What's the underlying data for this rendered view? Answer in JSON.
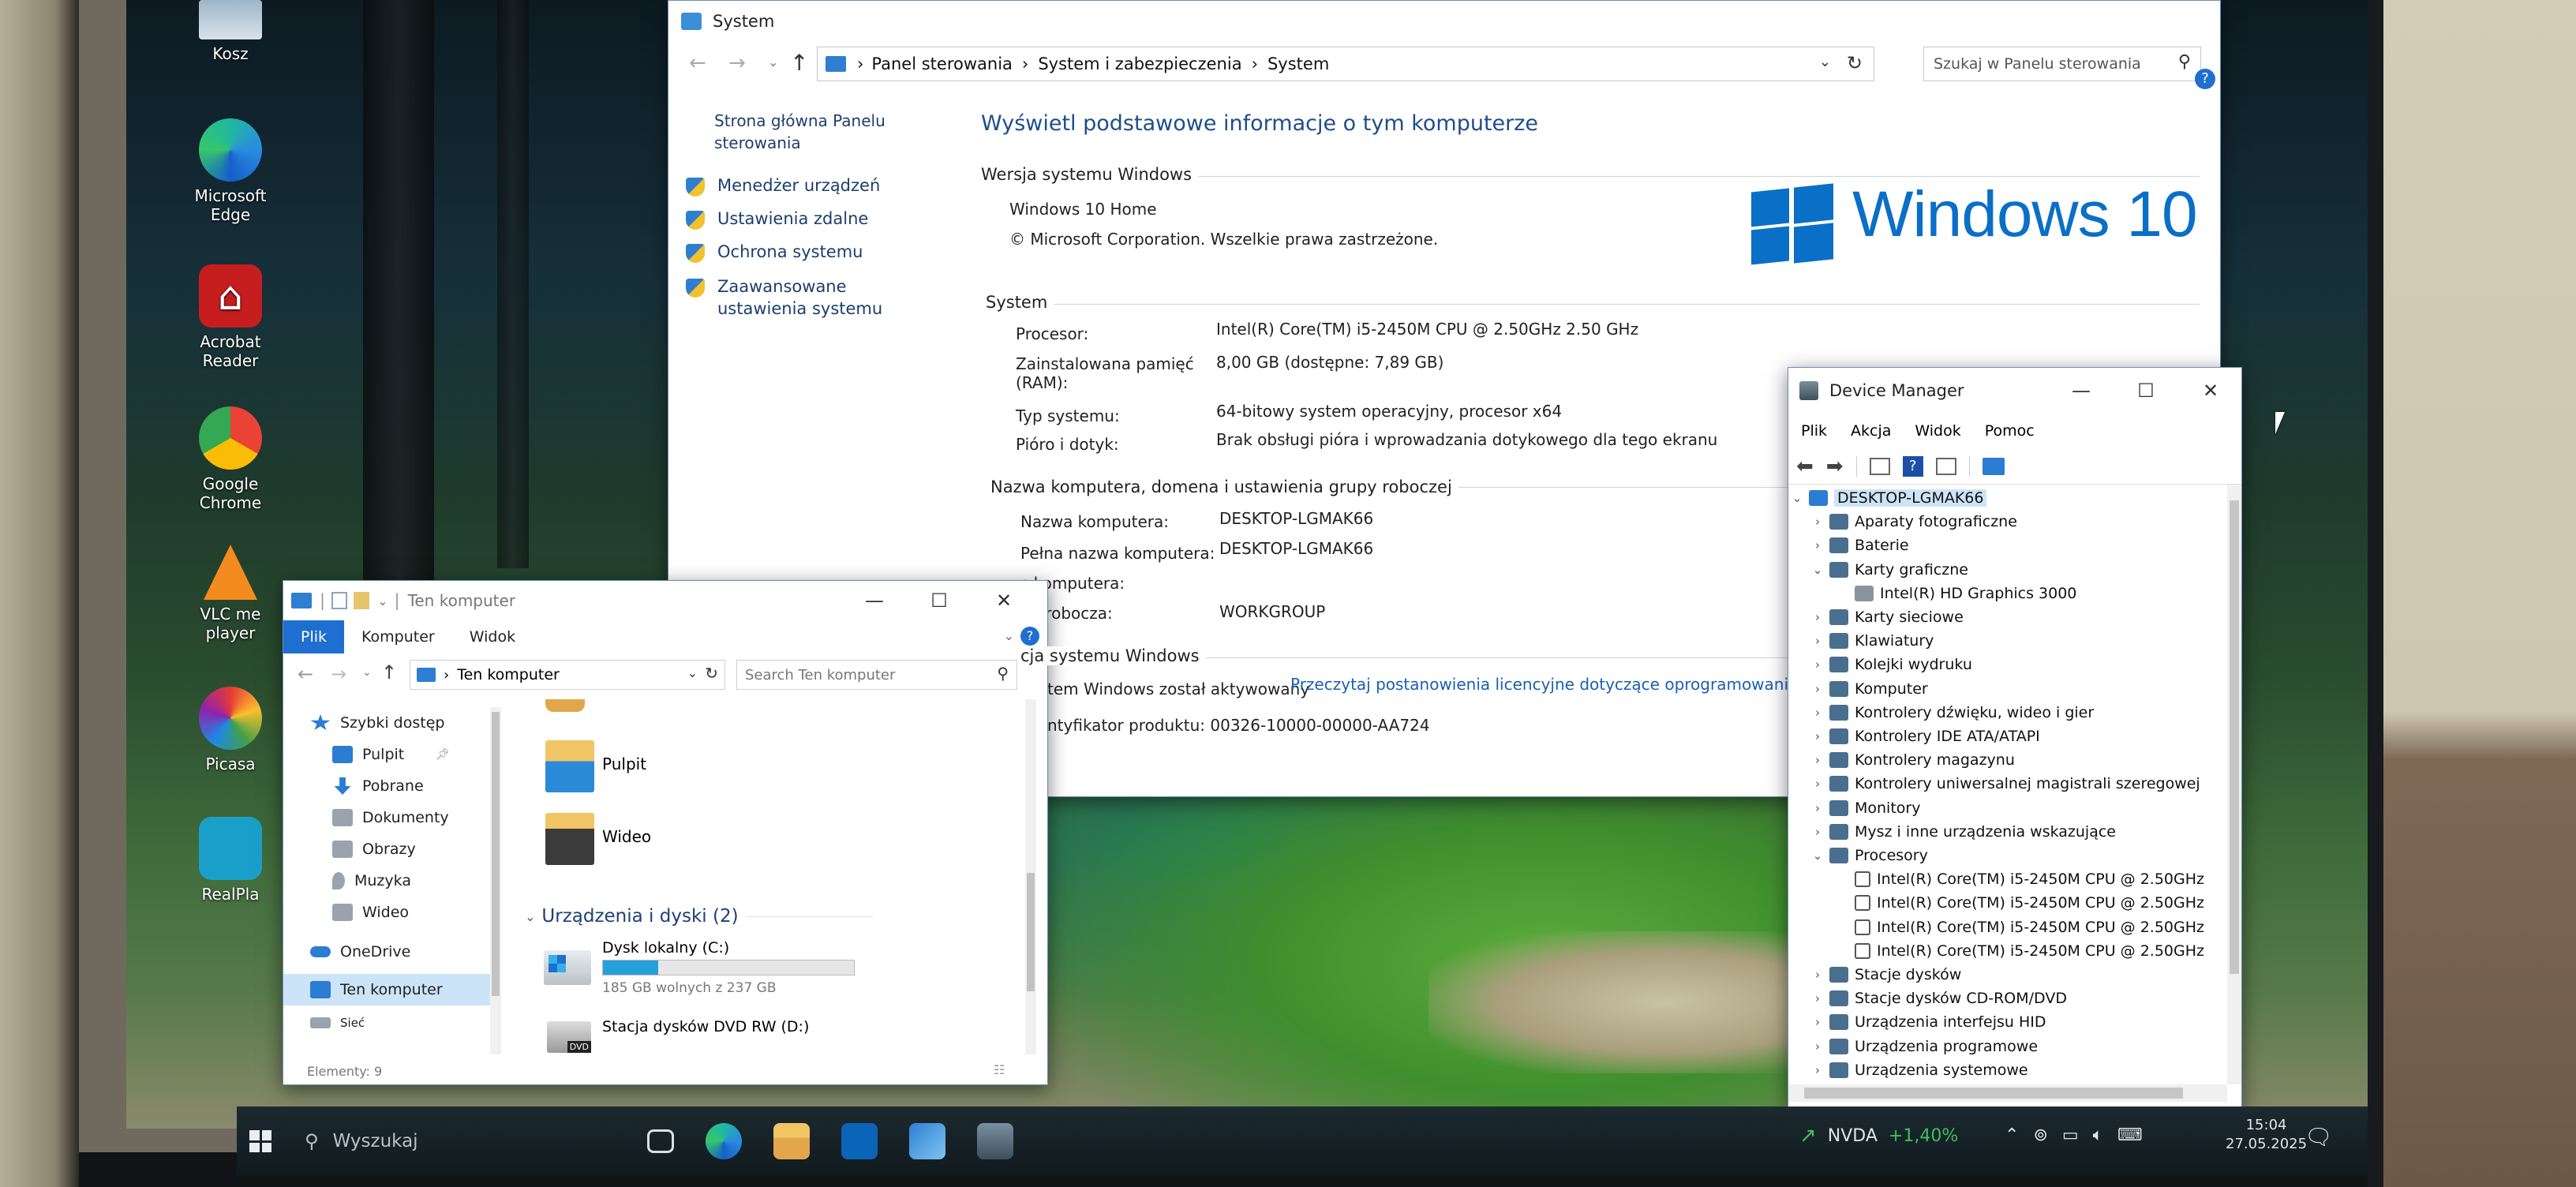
{
  "desktop": {
    "icons": [
      {
        "label": "Kosz",
        "name": "recycle-bin-icon"
      },
      {
        "label": "Microsoft Edge",
        "name": "edge-icon"
      },
      {
        "label": "Acrobat Reader",
        "name": "acrobat-icon"
      },
      {
        "label": "Google Chrome",
        "name": "chrome-icon"
      },
      {
        "label": "VLC me player",
        "name": "vlc-icon"
      },
      {
        "label": "Picasa",
        "name": "picasa-icon"
      },
      {
        "label": "RealPla",
        "name": "realplayer-icon"
      }
    ]
  },
  "control_panel": {
    "title": "System",
    "breadcrumb": [
      "Panel sterowania",
      "System i zabezpieczenia",
      "System"
    ],
    "search_placeholder": "Szukaj w Panelu sterowania",
    "sidebar": {
      "home": "Strona główna Panelu sterowania",
      "links": [
        "Menedżer urządzeń",
        "Ustawienia zdalne",
        "Ochrona systemu",
        "Zaawansowane ustawienia systemu"
      ]
    },
    "heading": "Wyświetl podstawowe informacje o tym komputerze",
    "edition_section": "Wersja systemu Windows",
    "edition": "Windows 10 Home",
    "copyright": "© Microsoft Corporation. Wszelkie prawa zastrzeżone.",
    "logo_text": "Windows 10",
    "system_section": "System",
    "system_rows": [
      {
        "label": "Procesor:",
        "value": "Intel(R) Core(TM) i5-2450M CPU @ 2.50GHz   2.50 GHz"
      },
      {
        "label": "Zainstalowana pamięć (RAM):",
        "value": "8,00 GB (dostępne: 7,89 GB)"
      },
      {
        "label": "Typ systemu:",
        "value": "64-bitowy system operacyjny, procesor x64"
      },
      {
        "label": "Pióro i dotyk:",
        "value": "Brak obsługi pióra i wprowadzania dotykowego dla tego ekranu"
      }
    ],
    "name_section": "Nazwa komputera, domena i ustawienia grupy roboczej",
    "name_rows": [
      {
        "label": "Nazwa komputera:",
        "value": "DESKTOP-LGMAK66"
      },
      {
        "label": "Pełna nazwa komputera:",
        "value": "DESKTOP-LGMAK66"
      },
      {
        "label": "s komputera:",
        "value": ""
      },
      {
        "label": "pa robocza:",
        "value": "WORKGROUP"
      }
    ],
    "activation_section": "cja systemu Windows",
    "activation_text": "tem Windows został aktywowany",
    "activation_link": "Przeczytaj postanowienia licencyjne dotyczące oprogramowania firmy",
    "product_id": "ntyfikator produktu: 00326-10000-00000-AA724"
  },
  "explorer": {
    "title": "Ten komputer",
    "tabs": [
      "Plik",
      "Komputer",
      "Widok"
    ],
    "address": "Ten komputer",
    "search_placeholder": "Search Ten komputer",
    "nav": [
      {
        "label": "Szybki dostęp",
        "color": "#2b7cd3"
      },
      {
        "label": "Pulpit",
        "color": "#2b7cd3"
      },
      {
        "label": "Pobrane",
        "color": "#2b7cd3"
      },
      {
        "label": "Dokumenty",
        "color": "#9aa3ad"
      },
      {
        "label": "Obrazy",
        "color": "#9aa3ad"
      },
      {
        "label": "Muzyka",
        "color": "#9aa3ad"
      },
      {
        "label": "Wideo",
        "color": "#9aa3ad"
      },
      {
        "label": "OneDrive",
        "color": "#2b7cd3"
      },
      {
        "label": "Ten komputer",
        "color": "#2b7cd3"
      },
      {
        "label": "Sieć",
        "color": "#9aa3ad"
      }
    ],
    "folders": [
      "Pulpit",
      "Wideo"
    ],
    "drives_header": "Urządzenia i dyski (2)",
    "drives": [
      {
        "name": "Dysk lokalny (C:)",
        "free": "185 GB wolnych z 237 GB",
        "used_fraction": 0.22
      },
      {
        "name": "Stacja dysków DVD RW (D:)",
        "badge": "DVD"
      }
    ],
    "status": "Elementy: 9"
  },
  "device_manager": {
    "title": "Device Manager",
    "menu": [
      "Plik",
      "Akcja",
      "Widok",
      "Pomoc"
    ],
    "root": "DESKTOP-LGMAK66",
    "tree": [
      {
        "label": "Aparaty fotograficzne",
        "level": 1,
        "expanded": false
      },
      {
        "label": "Baterie",
        "level": 1,
        "expanded": false
      },
      {
        "label": "Karty graficzne",
        "level": 1,
        "expanded": true
      },
      {
        "label": "Intel(R) HD Graphics 3000",
        "level": 2
      },
      {
        "label": "Karty sieciowe",
        "level": 1,
        "expanded": false
      },
      {
        "label": "Klawiatury",
        "level": 1,
        "expanded": false
      },
      {
        "label": "Kolejki wydruku",
        "level": 1,
        "expanded": false
      },
      {
        "label": "Komputer",
        "level": 1,
        "expanded": false
      },
      {
        "label": "Kontrolery dźwięku, wideo i gier",
        "level": 1,
        "expanded": false
      },
      {
        "label": "Kontrolery IDE ATA/ATAPI",
        "level": 1,
        "expanded": false
      },
      {
        "label": "Kontrolery magazynu",
        "level": 1,
        "expanded": false
      },
      {
        "label": "Kontrolery uniwersalnej magistrali szeregowej",
        "level": 1,
        "expanded": false
      },
      {
        "label": "Monitory",
        "level": 1,
        "expanded": false
      },
      {
        "label": "Mysz i inne urządzenia wskazujące",
        "level": 1,
        "expanded": false
      },
      {
        "label": "Procesory",
        "level": 1,
        "expanded": true
      },
      {
        "label": "Intel(R) Core(TM) i5-2450M CPU @ 2.50GHz",
        "level": 2
      },
      {
        "label": "Intel(R) Core(TM) i5-2450M CPU @ 2.50GHz",
        "level": 2
      },
      {
        "label": "Intel(R) Core(TM) i5-2450M CPU @ 2.50GHz",
        "level": 2
      },
      {
        "label": "Intel(R) Core(TM) i5-2450M CPU @ 2.50GHz",
        "level": 2
      },
      {
        "label": "Stacje dysków",
        "level": 1,
        "expanded": false
      },
      {
        "label": "Stacje dysków CD-ROM/DVD",
        "level": 1,
        "expanded": false
      },
      {
        "label": "Urządzenia interfejsu HID",
        "level": 1,
        "expanded": false
      },
      {
        "label": "Urządzenia programowe",
        "level": 1,
        "expanded": false
      },
      {
        "label": "Urządzenia systemowe",
        "level": 1,
        "expanded": false
      }
    ]
  },
  "taskbar": {
    "search_placeholder": "Wyszukaj",
    "stock_name": "NVDA",
    "stock_change": "+1,40%",
    "time": "15:04",
    "date": "27.05.2025",
    "apps": [
      "task-view-icon",
      "edge-icon",
      "file-explorer-icon",
      "outlook-icon",
      "control-panel-icon",
      "device-manager-icon"
    ]
  },
  "colors": {
    "accent": "#0078d7",
    "link": "#1a5fb4",
    "windows_logo": "#0a6fc7",
    "stock_green": "#3fbf5f"
  }
}
